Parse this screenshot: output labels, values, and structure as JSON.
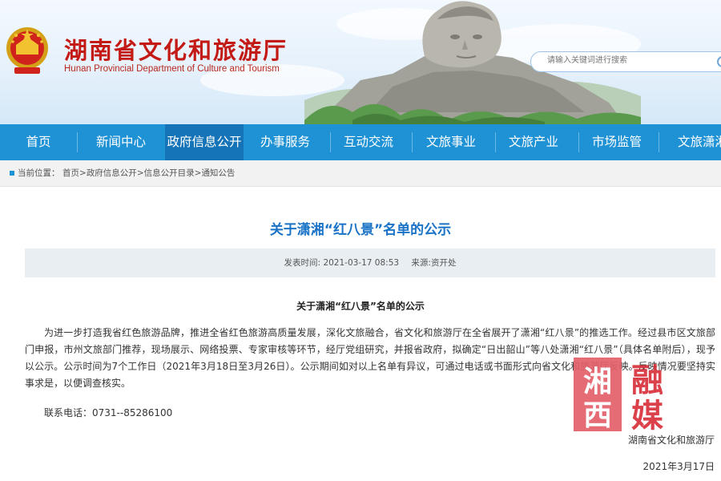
{
  "header": {
    "title": "湖南省文化和旅游厅",
    "subtitle": "Hunan Provincial Department of Culture and Tourism",
    "search_placeholder": "请输入关键词进行搜索"
  },
  "nav": {
    "items": [
      {
        "label": "首页"
      },
      {
        "label": "新闻中心"
      },
      {
        "label": "政府信息公开",
        "active": true
      },
      {
        "label": "办事服务"
      },
      {
        "label": "互动交流"
      },
      {
        "label": "文旅事业"
      },
      {
        "label": "文旅产业"
      },
      {
        "label": "市场监管"
      },
      {
        "label": "文旅潇湘"
      }
    ]
  },
  "breadcrumb": {
    "label": "当前位置：",
    "items": [
      "首页",
      "政府信息公开",
      "信息公开目录",
      "通知公告"
    ],
    "separator": ">"
  },
  "article": {
    "title": "关于潇湘“红八景”名单的公示",
    "publish_label": "发表时间:",
    "publish_time": "2021-03-17 08:53",
    "source_label": "来源:",
    "source": "资开处",
    "subtitle": "关于潇湘“红八景”名单的公示",
    "body": "为进一步打造我省红色旅游品牌，推进全省红色旅游高质量发展，深化文旅融合，省文化和旅游厅在全省展开了潇湘“红八景”的推选工作。经过县市区文旅部门申报，市州文旅部门推荐，现场展示、网络投票、专家审核等环节，经厅党组研究，并报省政府，拟确定“日出韶山”等八处潇湘“红八景”（具体名单附后），现予以公示。公示时间为7个工作日（2021年3月18日至3月26日）。公示期间如对以上名单有异议，可通过电话或书面形式向省文化和旅游厅反映。反映情况要坚持实事求是，以便调查核实。",
    "contact": "联系电话：0731--85286100",
    "signer": "湖南省文化和旅游厅",
    "date": "2021年3月17日"
  },
  "watermark": {
    "chars": [
      "湘",
      "西",
      "融",
      "媒"
    ]
  }
}
